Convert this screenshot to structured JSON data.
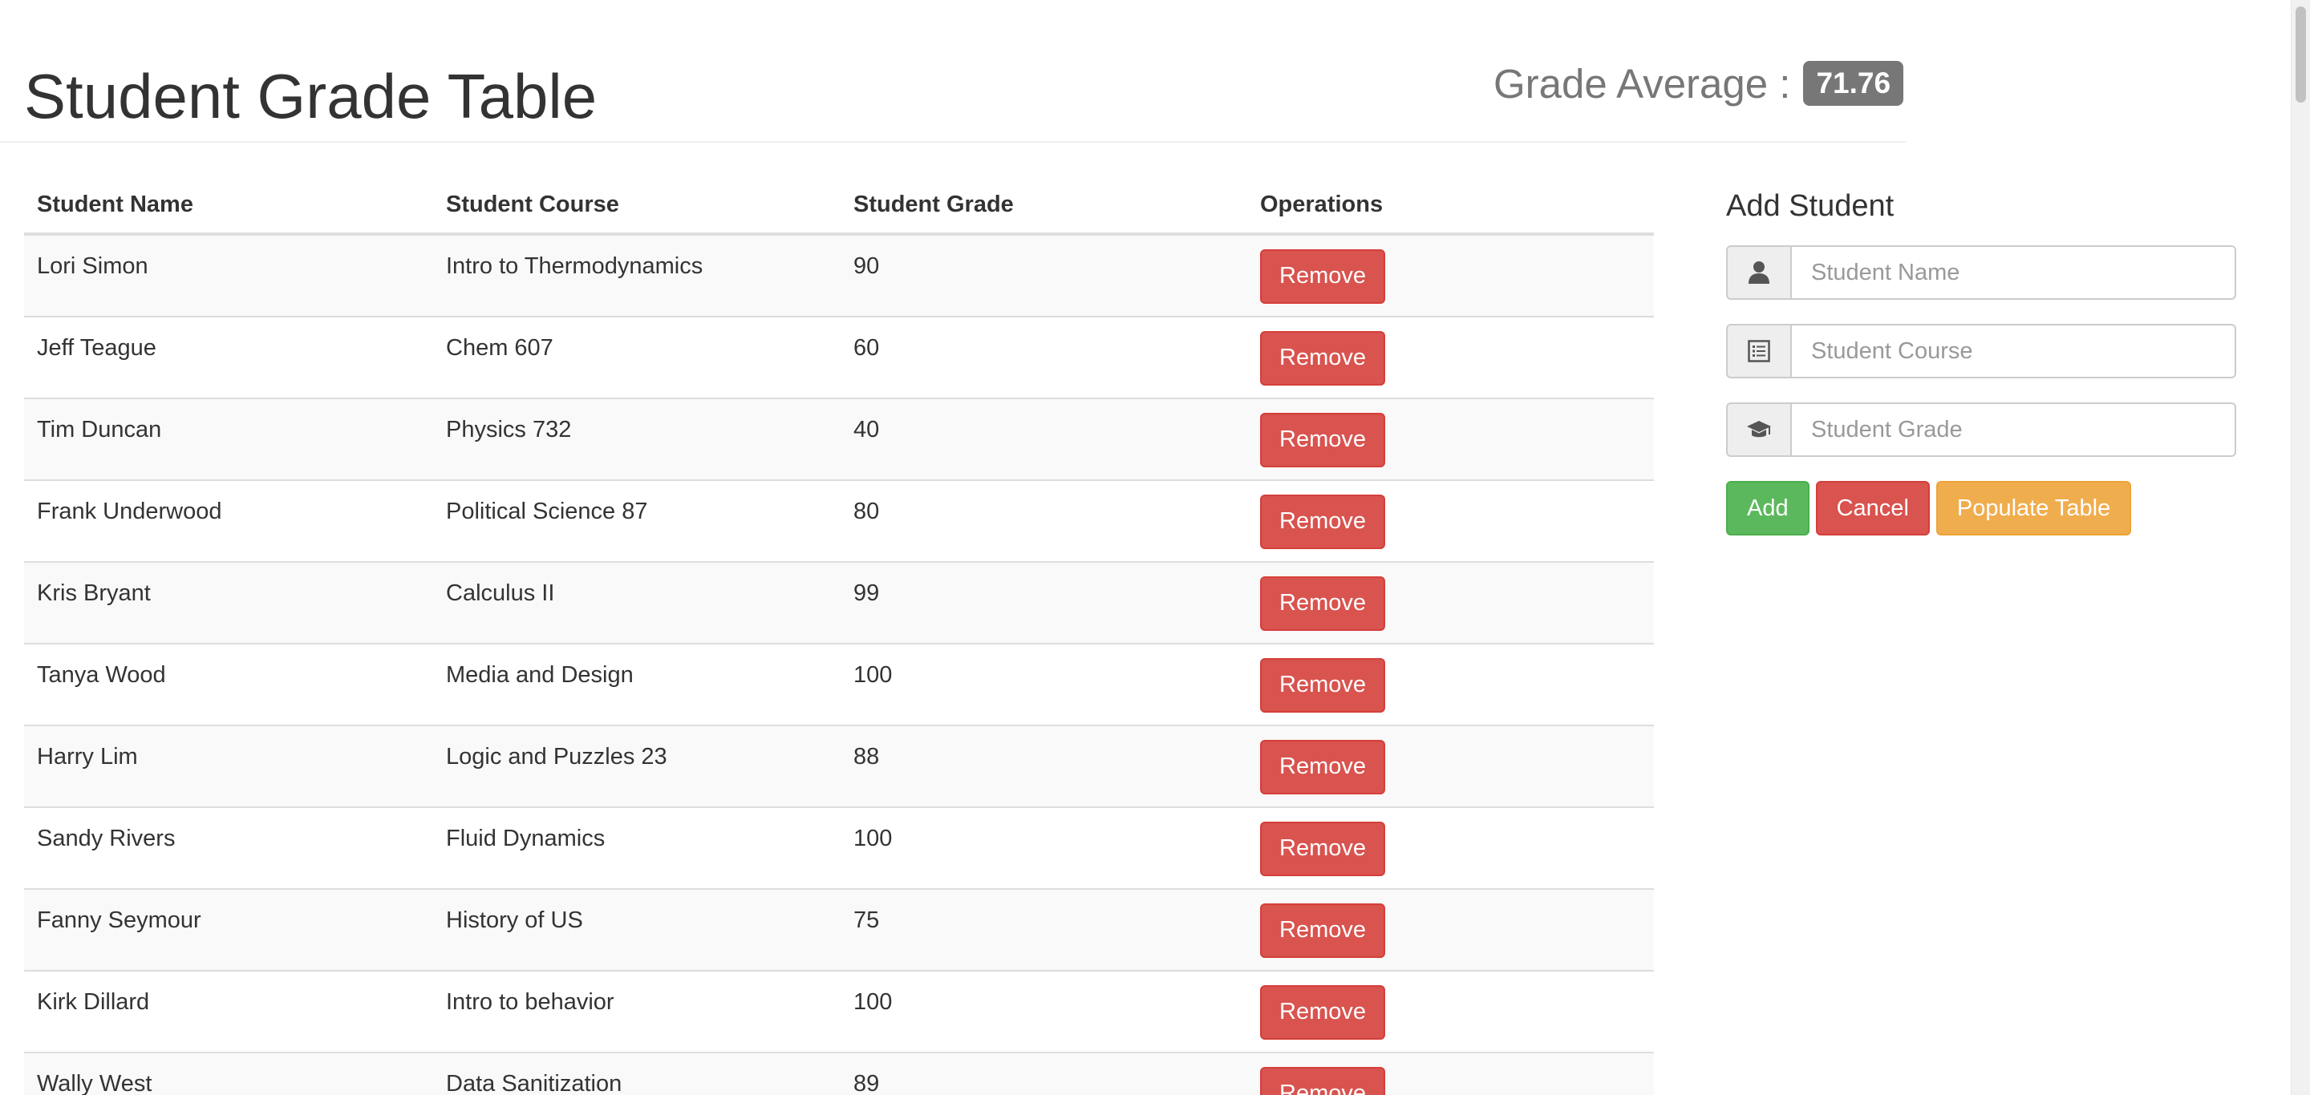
{
  "header": {
    "title": "Student Grade Table",
    "average_label": "Grade Average :",
    "average_value": "71.76"
  },
  "table": {
    "columns": [
      "Student Name",
      "Student Course",
      "Student Grade",
      "Operations"
    ],
    "rows": [
      {
        "name": "Lori Simon",
        "course": "Intro to Thermodynamics",
        "grade": "90",
        "action": "Remove"
      },
      {
        "name": "Jeff Teague",
        "course": "Chem 607",
        "grade": "60",
        "action": "Remove"
      },
      {
        "name": "Tim Duncan",
        "course": "Physics 732",
        "grade": "40",
        "action": "Remove"
      },
      {
        "name": "Frank Underwood",
        "course": "Political Science 87",
        "grade": "80",
        "action": "Remove"
      },
      {
        "name": "Kris Bryant",
        "course": "Calculus II",
        "grade": "99",
        "action": "Remove"
      },
      {
        "name": "Tanya Wood",
        "course": "Media and Design",
        "grade": "100",
        "action": "Remove"
      },
      {
        "name": "Harry Lim",
        "course": "Logic and Puzzles 23",
        "grade": "88",
        "action": "Remove"
      },
      {
        "name": "Sandy Rivers",
        "course": "Fluid Dynamics",
        "grade": "100",
        "action": "Remove"
      },
      {
        "name": "Fanny Seymour",
        "course": "History of US",
        "grade": "75",
        "action": "Remove"
      },
      {
        "name": "Kirk Dillard",
        "course": "Intro to behavior",
        "grade": "100",
        "action": "Remove"
      },
      {
        "name": "Wally West",
        "course": "Data Sanitization",
        "grade": "89",
        "action": "Remove"
      }
    ]
  },
  "add_form": {
    "title": "Add Student",
    "name_field": {
      "placeholder": "Student Name",
      "value": "",
      "icon": "user-icon"
    },
    "course_field": {
      "placeholder": "Student Course",
      "value": "",
      "icon": "list-alt-icon"
    },
    "grade_field": {
      "placeholder": "Student Grade",
      "value": "",
      "icon": "education-icon"
    },
    "add_label": "Add",
    "cancel_label": "Cancel",
    "populate_label": "Populate Table"
  },
  "colors": {
    "danger": "#d9534f",
    "success": "#5cb85c",
    "warning": "#f0ad4e",
    "badge": "#777777",
    "stripe": "#f9f9f9"
  }
}
